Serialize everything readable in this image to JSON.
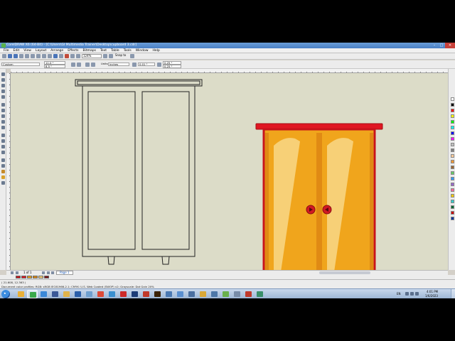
{
  "window": {
    "title": "CorelDRAW X6 (64-Bit) - [C:\\Users\\GI Multimedia Trainer\\Desktop\\cupboard 3.cdr]",
    "controls": {
      "minimize": "–",
      "maximize": "□",
      "close": "✕"
    }
  },
  "menu": {
    "items": [
      "File",
      "Edit",
      "View",
      "Layout",
      "Arrange",
      "Effects",
      "Bitmaps",
      "Text",
      "Table",
      "Tools",
      "Window",
      "Help"
    ]
  },
  "toolbar": {
    "zoom": "124%",
    "snap_to": "Snap to"
  },
  "property_bar": {
    "preset": "Custom",
    "page_width": "11.0 \"",
    "page_height": "8.5 \"",
    "units_label": "Units:",
    "units": "inches",
    "nudge": "0.01 \"",
    "dup_x": "0.25 \"",
    "dup_y": "0.25 \""
  },
  "page_nav": {
    "page_count": "1 of 1",
    "page_tab": "Page 1"
  },
  "status": {
    "coords": "( 21.608, 12.363 )",
    "profile": "Document color profiles: RGB: sRGB IEC61966-2.1; CMYK: U.S. Web Coated (SWOP) v2; Grayscale: Dot Gain 20%"
  },
  "tray": {
    "language": "EN",
    "time": "4:01 PM",
    "date": "1/6/2023"
  },
  "taskbar_apps": [
    {
      "icon": "explorer-icon",
      "color": "#e8b03a"
    },
    {
      "icon": "coreldraw-icon",
      "color": "#3aa84a"
    },
    {
      "icon": "chrome-icon",
      "color": "#3b88d8"
    },
    {
      "icon": "facebook-icon",
      "color": "#3b5998"
    },
    {
      "icon": "folder-icon",
      "color": "#e0b34a"
    },
    {
      "icon": "word-icon",
      "color": "#2b5faa"
    },
    {
      "icon": "paint-icon",
      "color": "#6fa0d0"
    },
    {
      "icon": "chrome-icon",
      "color": "#dd4b39"
    },
    {
      "icon": "network-icon",
      "color": "#3a8fd0"
    },
    {
      "icon": "opera-icon",
      "color": "#cc2a2a"
    },
    {
      "icon": "photoshop-icon",
      "color": "#1b3c78"
    },
    {
      "icon": "pdf-icon",
      "color": "#c0392b"
    },
    {
      "icon": "illustrator-icon",
      "color": "#3a2206"
    },
    {
      "icon": "image-viewer-icon",
      "color": "#4a79b3"
    },
    {
      "icon": "messenger-icon",
      "color": "#5a8fd0"
    },
    {
      "icon": "media-icon",
      "color": "#4a6fa0"
    },
    {
      "icon": "folder-icon",
      "color": "#d9a838"
    },
    {
      "icon": "video-icon",
      "color": "#4d77a8"
    },
    {
      "icon": "corel-balloon-icon",
      "color": "#6ab04c"
    },
    {
      "icon": "settings-icon",
      "color": "#788ca8"
    },
    {
      "icon": "record-icon",
      "color": "#c0392b"
    },
    {
      "icon": "camtasia-icon",
      "color": "#3a8f6a"
    }
  ],
  "palette": [
    "#ffffff",
    "#000000",
    "#ff0000",
    "#ffff00",
    "#00ff00",
    "#00ffff",
    "#0000ff",
    "#ff00ff",
    "#c0c0c0",
    "#808080",
    "#ffcc99",
    "#ff9933",
    "#996633",
    "#66cc66",
    "#3399ff",
    "#9966cc",
    "#ff6699",
    "#ffcc00",
    "#33cccc",
    "#006633",
    "#cc0000",
    "#003399"
  ],
  "colors": {
    "cupboard_body": "#f0a51c",
    "cupboard_border": "#c8131b",
    "cupboard_top": "#e01722",
    "cupboard_glass": "#f7d077",
    "cupboard_stripe": "#e08a14",
    "cupboard_leg": "#7a1418",
    "knob": "#d11a23"
  }
}
